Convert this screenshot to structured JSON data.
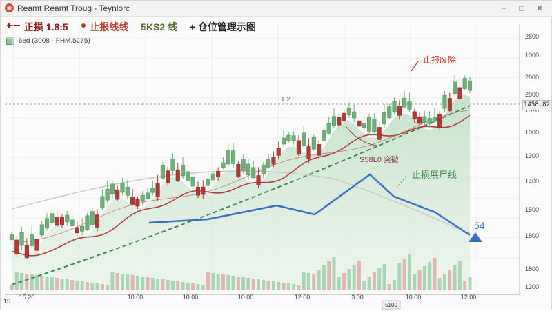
{
  "window": {
    "title": "Reamt Reamt Troug - Teynlorc",
    "icon_glyph": "◉",
    "controls": {
      "minimize": "−",
      "maximize": "□",
      "close": "✕"
    }
  },
  "legend": {
    "items": [
      {
        "label": "正损 1.8:5",
        "color": "#8b1a1a",
        "icon": "arrow-line-icon"
      },
      {
        "label": "止报线线",
        "color": "#c0392b",
        "icon": "dot-icon"
      },
      {
        "label": "5KS2 线",
        "color": "#556b2f",
        "icon": "text-icon"
      },
      {
        "label": "仓位管理示图",
        "color": "#222222",
        "icon": "plus-icon"
      }
    ],
    "subtitle": "6ed  (3008 - FHM.5275)"
  },
  "price_badge": "1458.82",
  "chart_data": {
    "type": "candlestick",
    "title": "",
    "x_tick_labels": [
      "15.20",
      "10.00",
      "10.00",
      "10.00",
      "12.00",
      "3.00",
      "10.00",
      "12.00"
    ],
    "bottom_axis_badge": "5100",
    "bottom_left_label": "15",
    "y_tick_labels": [
      "2800",
      "1000",
      "2800",
      "2800",
      "1020",
      "1000",
      "1300",
      "1400",
      "1500",
      "1800",
      "1800",
      "1300"
    ],
    "annotations": [
      {
        "text": "止报废除",
        "color": "#c0392b"
      },
      {
        "text": "1.2",
        "color": "#555555"
      },
      {
        "text": "S58L0 突破",
        "color": "#8b3a3a"
      },
      {
        "text": "止损展尸线",
        "color": "#3b8a4a"
      },
      {
        "text": "54",
        "color": "#3a6fc4"
      }
    ],
    "series": [
      {
        "name": "candles",
        "up_color": "#6fb07a",
        "down_color": "#b03a36"
      },
      {
        "name": "trend",
        "color": "#3a6fc4"
      },
      {
        "name": "stop-line",
        "color": "#3a8a4a"
      },
      {
        "name": "ma-fast",
        "color": "#b23b3b"
      }
    ],
    "grid": true,
    "volume": true
  }
}
